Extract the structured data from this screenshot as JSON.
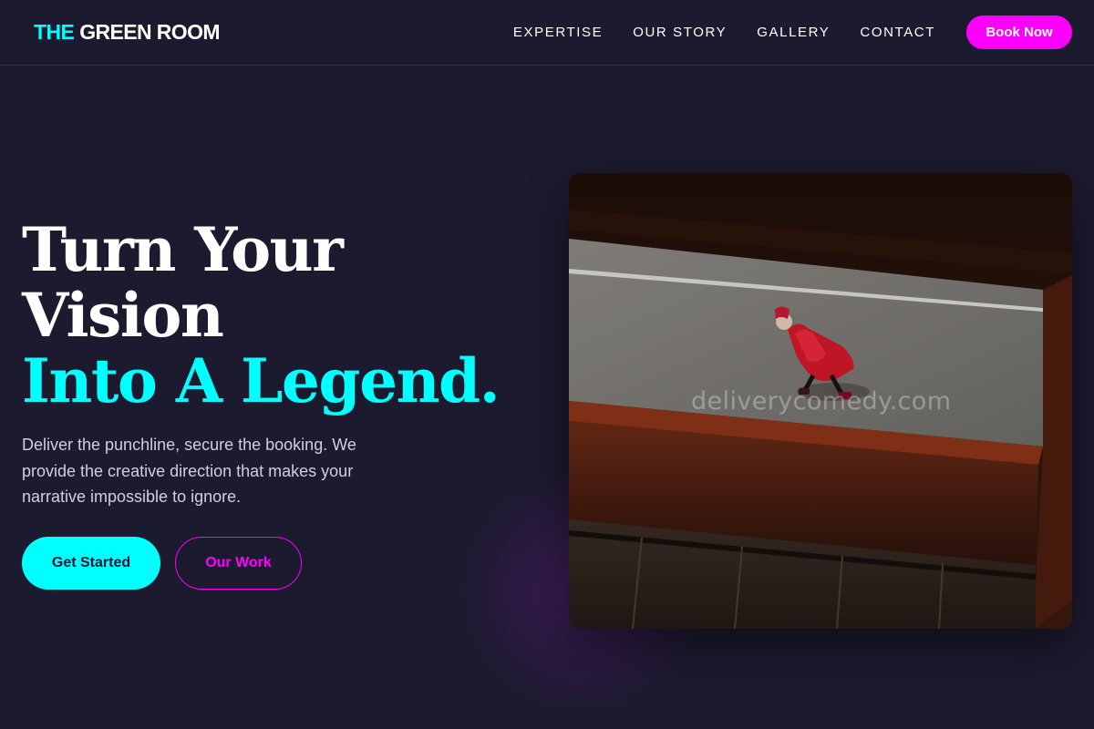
{
  "header": {
    "logo_accent": "THE",
    "logo_main": "GREEN ROOM",
    "nav": [
      "EXPERTISE",
      "OUR STORY",
      "GALLERY",
      "CONTACT"
    ],
    "cta": "Book Now"
  },
  "hero": {
    "title_line1": "Turn Your",
    "title_line2": "Vision",
    "title_accent": "Into A Legend.",
    "description": "Deliver the punchline, secure the booking. We provide the creative direction that makes your narrative impossible to ignore.",
    "primary_button": "Get Started",
    "secondary_button": "Our Work",
    "image_watermark": "deliverycomedy.com"
  },
  "colors": {
    "background": "#1c1a2e",
    "accent_cyan": "#00ffff",
    "accent_magenta": "#ff00ff",
    "text_muted": "#d0cfe0"
  }
}
